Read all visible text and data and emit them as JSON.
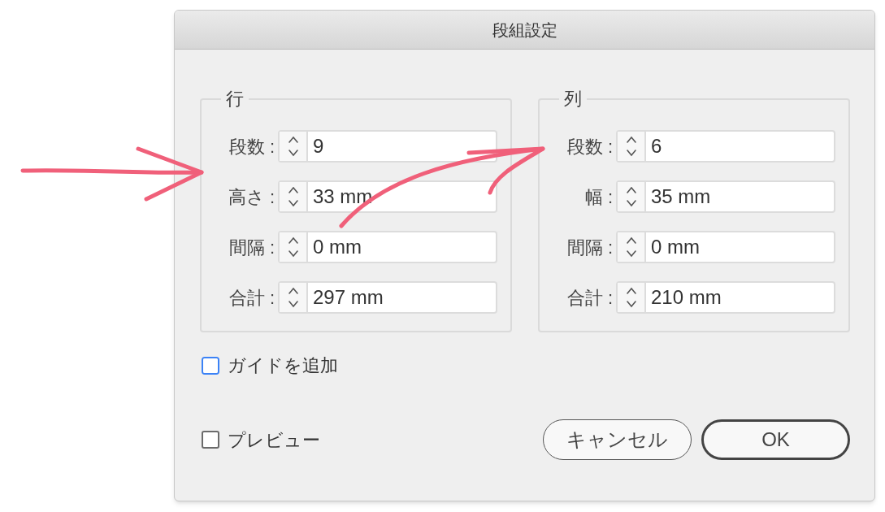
{
  "window": {
    "title": "段組設定"
  },
  "groups": [
    {
      "title": "行",
      "fields": [
        {
          "label": "段数 :",
          "value": "9"
        },
        {
          "label": "高さ :",
          "value": "33 mm"
        },
        {
          "label": "間隔 :",
          "value": "0 mm"
        },
        {
          "label": "合計 :",
          "value": "297 mm"
        }
      ]
    },
    {
      "title": "列",
      "fields": [
        {
          "label": "段数 :",
          "value": "6"
        },
        {
          "label": "幅 :",
          "value": "35 mm"
        },
        {
          "label": "間隔 :",
          "value": "0 mm"
        },
        {
          "label": "合計 :",
          "value": "210 mm"
        }
      ]
    }
  ],
  "add_guides": {
    "label": "ガイドを追加",
    "checked": false,
    "focused": true
  },
  "preview": {
    "label": "プレビュー",
    "checked": false
  },
  "buttons": [
    {
      "label": "キャンセル",
      "default": false
    },
    {
      "label": "OK",
      "default": true
    }
  ]
}
